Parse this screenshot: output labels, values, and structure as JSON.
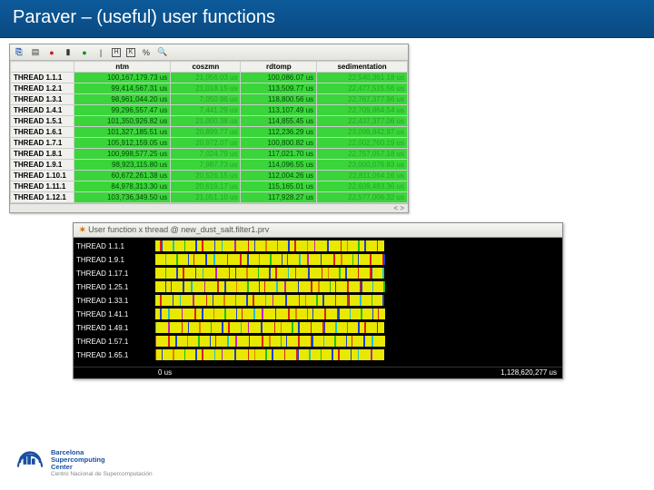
{
  "title": "Paraver – (useful) user functions",
  "toolbar_icons": [
    "copy",
    "palette",
    "red-dot",
    "bar",
    "green-dot",
    "pipe",
    "h-box",
    "k-box",
    "pct",
    "search"
  ],
  "table": {
    "columns": [
      "",
      "ntm",
      "coszmn",
      "rdtomp",
      "sedimentation"
    ],
    "rows": [
      {
        "hdr": "THREAD 1.1.1",
        "cells": [
          "100,167,179.73 us",
          "21,056.03 us",
          "100,086.07 us",
          "22,540,361.18 us"
        ]
      },
      {
        "hdr": "THREAD 1.2.1",
        "cells": [
          "99,414,567.31 us",
          "21,018.15 us",
          "113,509.77 us",
          "22,477,515.56 us"
        ]
      },
      {
        "hdr": "THREAD 1.3.1",
        "cells": [
          "98,961,044.20 us",
          "7,050.96 us",
          "118,800.56 us",
          "22,767,377.96 us"
        ]
      },
      {
        "hdr": "THREAD 1.4.1",
        "cells": [
          "99,296,557.47 us",
          "7,441.29 us",
          "113,107.49 us",
          "22,709,864.54 us"
        ]
      },
      {
        "hdr": "THREAD 1.5.1",
        "cells": [
          "101,350,926.82 us",
          "21,000.38 us",
          "114,855.45 us",
          "22,437,377.06 us"
        ]
      },
      {
        "hdr": "THREAD 1.6.1",
        "cells": [
          "101,327,185.51 us",
          "20,899.77 us",
          "112,236.29 us",
          "23,099,842.97 us"
        ]
      },
      {
        "hdr": "THREAD 1.7.1",
        "cells": [
          "105,912,159.05 us",
          "20,972.07 us",
          "100,800.82 us",
          "22,002,760.19 us"
        ]
      },
      {
        "hdr": "THREAD 1.8.1",
        "cells": [
          "100,998,577.25 us",
          "7,024.79 us",
          "117,021.70 us",
          "22,757,057.18 us"
        ]
      },
      {
        "hdr": "THREAD 1.9.1",
        "cells": [
          "98,923,115.80 us",
          "7,987.73 us",
          "114,096.55 us",
          "23,000,076.83 us"
        ]
      },
      {
        "hdr": "THREAD 1.10.1",
        "cells": [
          "60,672,261.38 us",
          "20,526.15 us",
          "112,004.26 us",
          "22,811,064.16 us"
        ]
      },
      {
        "hdr": "THREAD 1.11.1",
        "cells": [
          "84,978,313.30 us",
          "20,619.17 us",
          "115,165.01 us",
          "22,609,483.36 us"
        ]
      },
      {
        "hdr": "THREAD 1.12.1",
        "cells": [
          "103,736,349.50 us",
          "21,051.10 us",
          "117,928.27 us",
          "22,577,006.32 us"
        ]
      }
    ],
    "scroll_hint": "< >"
  },
  "timeline": {
    "title": "User function x thread @ new_dust_salt.filter1.prv",
    "threads": [
      "THREAD 1.1.1",
      "THREAD 1.9.1",
      "THREAD 1.17.1",
      "THREAD 1.25.1",
      "THREAD 1.33.1",
      "THREAD 1.41.1",
      "THREAD 1.49.1",
      "THREAD 1.57.1",
      "THREAD 1.65.1"
    ],
    "axis_start": "0 us",
    "axis_end": "1,128,620,277 us",
    "pattern": [
      "y",
      "r",
      "b",
      "y",
      "y",
      "c",
      "y",
      "y",
      "g",
      "y",
      "y",
      "b",
      "y",
      "r",
      "y",
      "y",
      "b",
      "y",
      "c",
      "y",
      "y",
      "m",
      "y",
      "y",
      "r",
      "y",
      "b",
      "y",
      "y",
      "o",
      "y",
      "y",
      "g",
      "y",
      "y",
      "b",
      "y",
      "r",
      "y",
      "y",
      "c",
      "y",
      "m",
      "y",
      "y",
      "b",
      "y",
      "y",
      "r",
      "y",
      "o",
      "y",
      "y",
      "g",
      "y",
      "b",
      "y",
      "y",
      "r",
      "y"
    ]
  },
  "logo": {
    "l1": "Barcelona",
    "l2": "Supercomputing",
    "l3": "Center",
    "sub": "Centro Nacional de Supercomputación"
  }
}
